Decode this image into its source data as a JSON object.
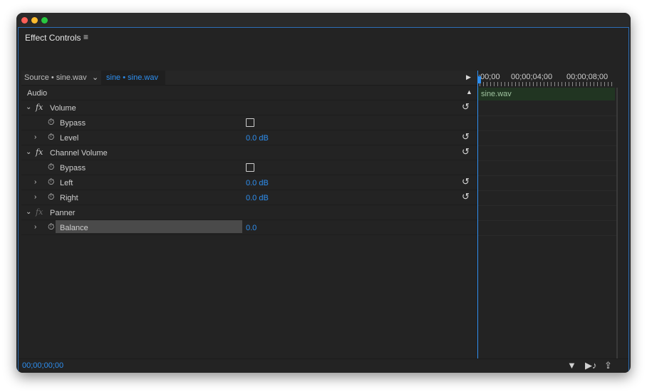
{
  "panel": {
    "title": "Effect Controls",
    "menu_icon": "≡"
  },
  "tabs": {
    "source_label": "Source • sine.wav",
    "clip_label": "sine • sine.wav"
  },
  "section": {
    "label": "Audio"
  },
  "effects": [
    {
      "name": "Volume",
      "params": [
        {
          "label": "Bypass",
          "type": "checkbox"
        },
        {
          "label": "Level",
          "value": "0.0 dB"
        }
      ]
    },
    {
      "name": "Channel Volume",
      "params": [
        {
          "label": "Bypass",
          "type": "checkbox"
        },
        {
          "label": "Left",
          "value": "0.0 dB"
        },
        {
          "label": "Right",
          "value": "0.0 dB"
        }
      ]
    },
    {
      "name": "Panner",
      "params": [
        {
          "label": "Balance",
          "value": "0.0"
        }
      ]
    }
  ],
  "timeline": {
    "tc_start": ";00;00",
    "tc_mid": "00;00;04;00",
    "tc_end": "00;00;08;00",
    "clip_name": "sine.wav"
  },
  "footer": {
    "timecode": "00;00;00;00"
  },
  "icons": {
    "menu": "hamburger-icon",
    "play": "play-icon",
    "reset": "reset-icon",
    "stopwatch": "stopwatch-icon",
    "filter": "filter-icon",
    "play_audio": "play-audio-icon",
    "export": "export-icon"
  },
  "colors": {
    "accent": "#2e8ff0",
    "panel_bg": "#232323",
    "clip_bg": "#213522"
  }
}
